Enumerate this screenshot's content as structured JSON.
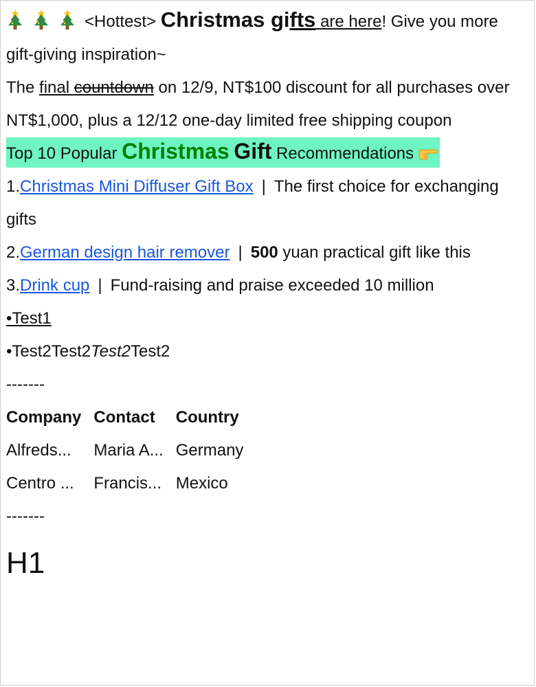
{
  "headline": {
    "hottest": "<Hottest>",
    "christmas_gi": "Christmas gi",
    "fts": "fts",
    "are_here": " are here",
    "rest": "! Give you more gift-giving inspiration~"
  },
  "countdown": {
    "prefix": "The ",
    "final": "final ",
    "countdown_word": "countdown",
    "rest": " on 12/9, NT$100 discount for all purchases over NT$1,000, plus a 12/12 one-day limited free shipping coupon"
  },
  "top10": {
    "prefix": "Top 10 Popular ",
    "christmas": "Christmas",
    "gift": "Gift",
    "suffix": " Recommendations"
  },
  "items": [
    {
      "num": "1.",
      "link": "Christmas Mini Diffuser Gift Box",
      "sep": "|",
      "desc": "The first choice for exchanging gifts"
    },
    {
      "num": "2.",
      "link": "German design hair remover",
      "sep": "|",
      "desc_bold": "500",
      "desc": " yuan practical gift like this"
    },
    {
      "num": "3.",
      "link": "Drink cup",
      "sep": "|",
      "desc": "Fund-raising and praise exceeded 10 million"
    }
  ],
  "bullets": {
    "test1": "•Test1",
    "test2_a": "•Test2Test2",
    "test2_b": "Test2",
    "test2_c": "Test2"
  },
  "divider": "-------",
  "table": {
    "headers": [
      "Company",
      "Contact",
      "Country"
    ],
    "rows": [
      [
        "Alfreds...",
        "Maria A...",
        "Germany"
      ],
      [
        "Centro ...",
        "Francis...",
        "Mexico"
      ]
    ]
  },
  "h1": "H1",
  "colors": {
    "highlight": "#6ff5c3",
    "christmas_green": "#008000",
    "link_blue": "#1a56db"
  },
  "icons": [
    "christmas-tree-icon",
    "christmas-tree-icon",
    "christmas-tree-icon",
    "pointing-hand-icon"
  ]
}
